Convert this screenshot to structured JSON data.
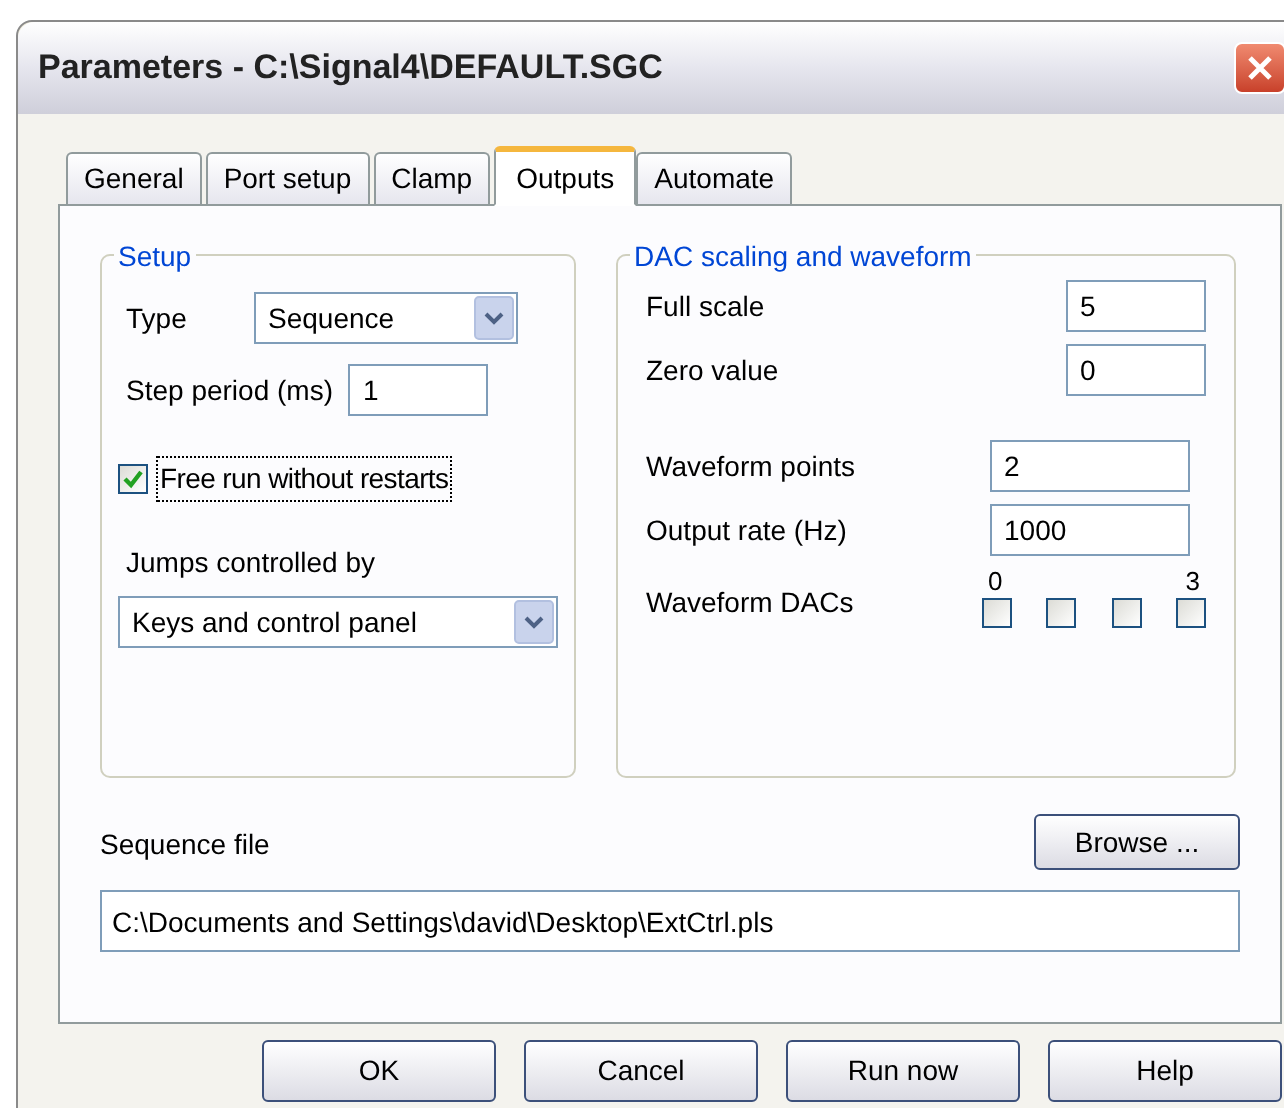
{
  "window": {
    "title": "Parameters - C:\\Signal4\\DEFAULT.SGC"
  },
  "tabs": [
    {
      "label": "General",
      "selected": false
    },
    {
      "label": "Port setup",
      "selected": false
    },
    {
      "label": "Clamp",
      "selected": false
    },
    {
      "label": "Outputs",
      "selected": true
    },
    {
      "label": "Automate",
      "selected": false
    }
  ],
  "setup": {
    "title": "Setup",
    "type_label": "Type",
    "type_value": "Sequence",
    "step_label": "Step period (ms)",
    "step_value": "1",
    "free_run": {
      "label": "Free run without restarts",
      "checked": true
    },
    "jumps_label": "Jumps controlled by",
    "jumps_value": "Keys and control panel"
  },
  "dac": {
    "title": "DAC scaling and waveform",
    "fields": [
      {
        "label": "Full scale",
        "value": "5"
      },
      {
        "label": "Zero value",
        "value": "0"
      }
    ],
    "waveform_fields": [
      {
        "label": "Waveform points",
        "value": "2"
      },
      {
        "label": "Output rate (Hz)",
        "value": "1000"
      }
    ],
    "dacs_label": "Waveform DACs",
    "dacs_first": "0",
    "dacs_last": "3",
    "dacs": [
      {
        "checked": false
      },
      {
        "checked": false
      },
      {
        "checked": false
      },
      {
        "checked": false
      }
    ]
  },
  "sequence_file": {
    "label": "Sequence file",
    "browse": "Browse ...",
    "value": "C:\\Documents and Settings\\david\\Desktop\\ExtCtrl.pls"
  },
  "buttons": [
    "OK",
    "Cancel",
    "Run now",
    "Help"
  ]
}
